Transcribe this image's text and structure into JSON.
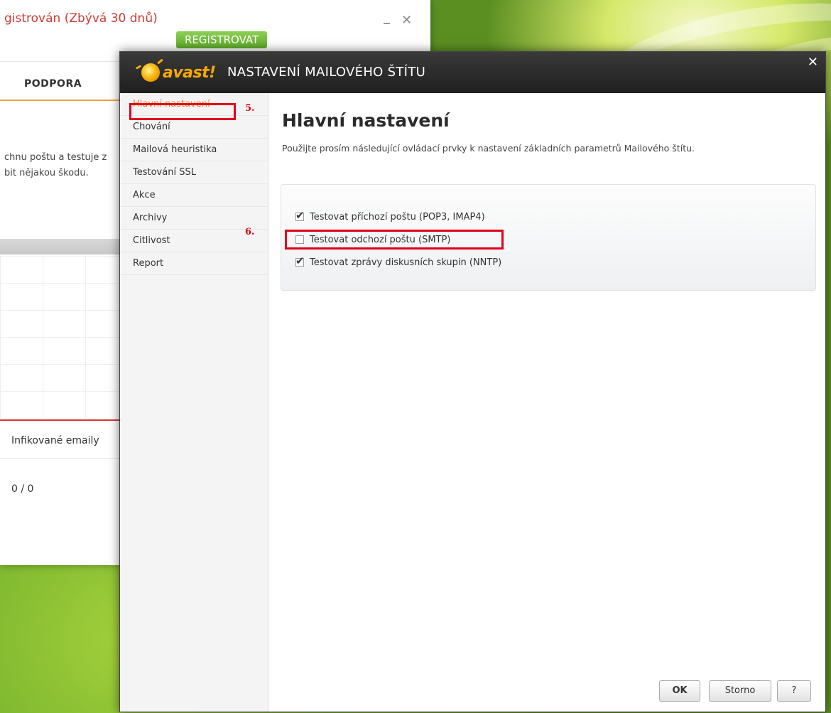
{
  "main_window": {
    "registration_text": "gistrován (Zbývá 30 dnů)",
    "register_button": "REGISTROVAT",
    "minimize_label": "_",
    "close_label": "✕",
    "tab_support": "PODPORA",
    "desc_line1": "chnu poštu a testuje z",
    "desc_line2": "bit nějakou škodu.",
    "infected_emails_label": "Infikované emaily",
    "infected_emails_value": "0 / 0"
  },
  "dialog": {
    "logo_text": "avast!",
    "title": "NASTAVENÍ MAILOVÉHO ŠTÍTU",
    "close_label": "✕",
    "sidebar": {
      "items": [
        {
          "label": "Hlavní nastavení",
          "active": true
        },
        {
          "label": "Chování",
          "active": false
        },
        {
          "label": "Mailová heuristika",
          "active": false
        },
        {
          "label": "Testování SSL",
          "active": false
        },
        {
          "label": "Akce",
          "active": false
        },
        {
          "label": "Archivy",
          "active": false
        },
        {
          "label": "Citlivost",
          "active": false
        },
        {
          "label": "Report",
          "active": false
        }
      ]
    },
    "annotations": {
      "step5": "5.",
      "step6": "6."
    },
    "content": {
      "heading": "Hlavní nastavení",
      "description": "Použijte prosím následující ovládací prvky k nastavení základních parametrů Mailového štítu.",
      "options": [
        {
          "label": "Testovat příchozí poštu (POP3, IMAP4)",
          "checked": true
        },
        {
          "label": "Testovat odchozí poštu (SMTP)",
          "checked": false
        },
        {
          "label": "Testovat zprávy diskusních skupin (NNTP)",
          "checked": true
        }
      ]
    },
    "buttons": {
      "ok": "OK",
      "cancel": "Storno",
      "help": "?"
    }
  },
  "colors": {
    "accent_orange": "#e67e22",
    "highlight_red": "#e2001a",
    "register_green": "#5ea92a",
    "header_dark": "#1f1f1f"
  }
}
